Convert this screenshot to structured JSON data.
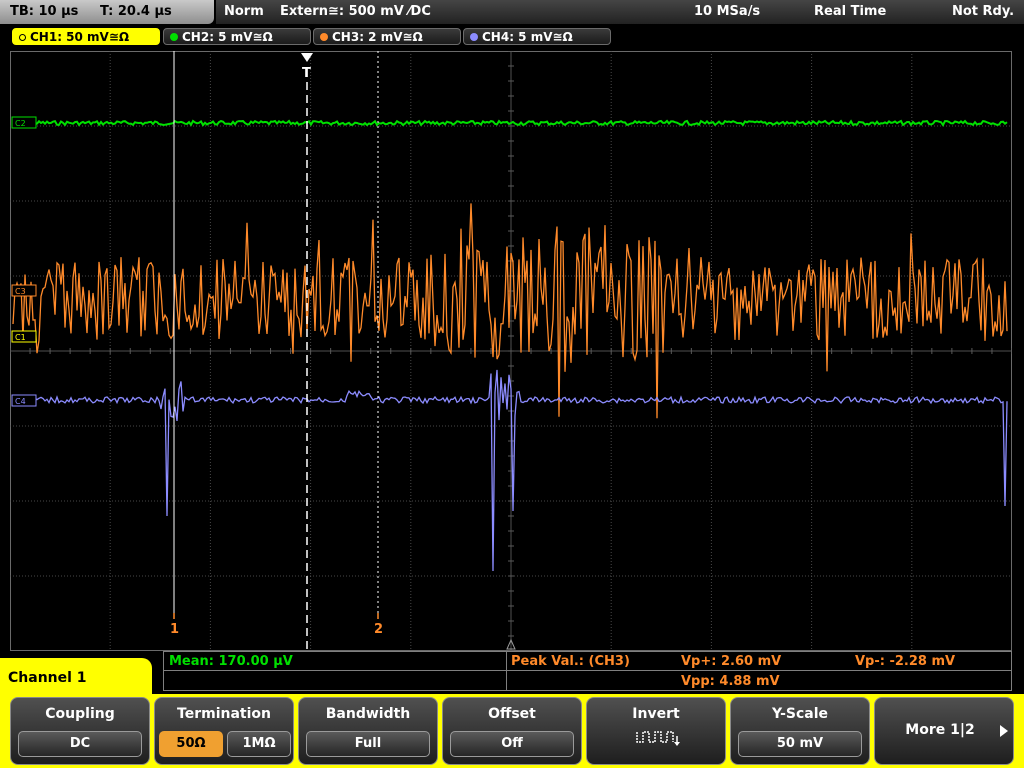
{
  "topbar": {
    "timebase": "TB: 10 µs",
    "trigger_time": "T: 20.4 µs",
    "trigger_mode": "Norm",
    "trigger_source": "Extern≅: 500 mV ⁄DC",
    "sample_rate": "10 MSa/s",
    "acq_mode": "Real Time",
    "status": "Not Rdy."
  },
  "channels": [
    {
      "label": "CH1: 50 mV≅Ω",
      "color": "#ffff00",
      "active": true
    },
    {
      "label": "CH2: 5 mV≅Ω",
      "color": "#00e000",
      "active": false
    },
    {
      "label": "CH3: 2 mV≅Ω",
      "color": "#ff8a2a",
      "active": false
    },
    {
      "label": "CH4: 5 mV≅Ω",
      "color": "#8c8cff",
      "active": false
    }
  ],
  "markers": {
    "cursor1": "1",
    "cursor2": "2",
    "trigger": "T",
    "ch2_ref": "C2",
    "ch3_ref": "C3",
    "ch1_ref": "C1",
    "ch4_ref": "C4"
  },
  "measure": {
    "mean": "Mean: 170.00 µV",
    "peak_label": "Peak Val.:  (CH3)",
    "vp_plus": "Vp+: 2.60 mV",
    "vp_minus": "Vp-: -2.28 mV",
    "vpp": "Vpp: 4.88 mV"
  },
  "menu": {
    "channel_title": "Channel 1",
    "coupling": {
      "title": "Coupling",
      "value": "DC"
    },
    "termination": {
      "title": "Termination",
      "opt1": "50Ω",
      "opt2": "1MΩ"
    },
    "bandwidth": {
      "title": "Bandwidth",
      "value": "Full"
    },
    "offset": {
      "title": "Offset",
      "value": "Off"
    },
    "invert": {
      "title": "Invert"
    },
    "yscale": {
      "title": "Y-Scale",
      "value": "50 mV"
    },
    "more": {
      "label": "More 1|2"
    }
  },
  "colors": {
    "ch1": "#ffff00",
    "ch2": "#00e000",
    "ch3": "#ff8a2a",
    "ch4": "#8c8cff",
    "grid": "#5a5a5a"
  }
}
